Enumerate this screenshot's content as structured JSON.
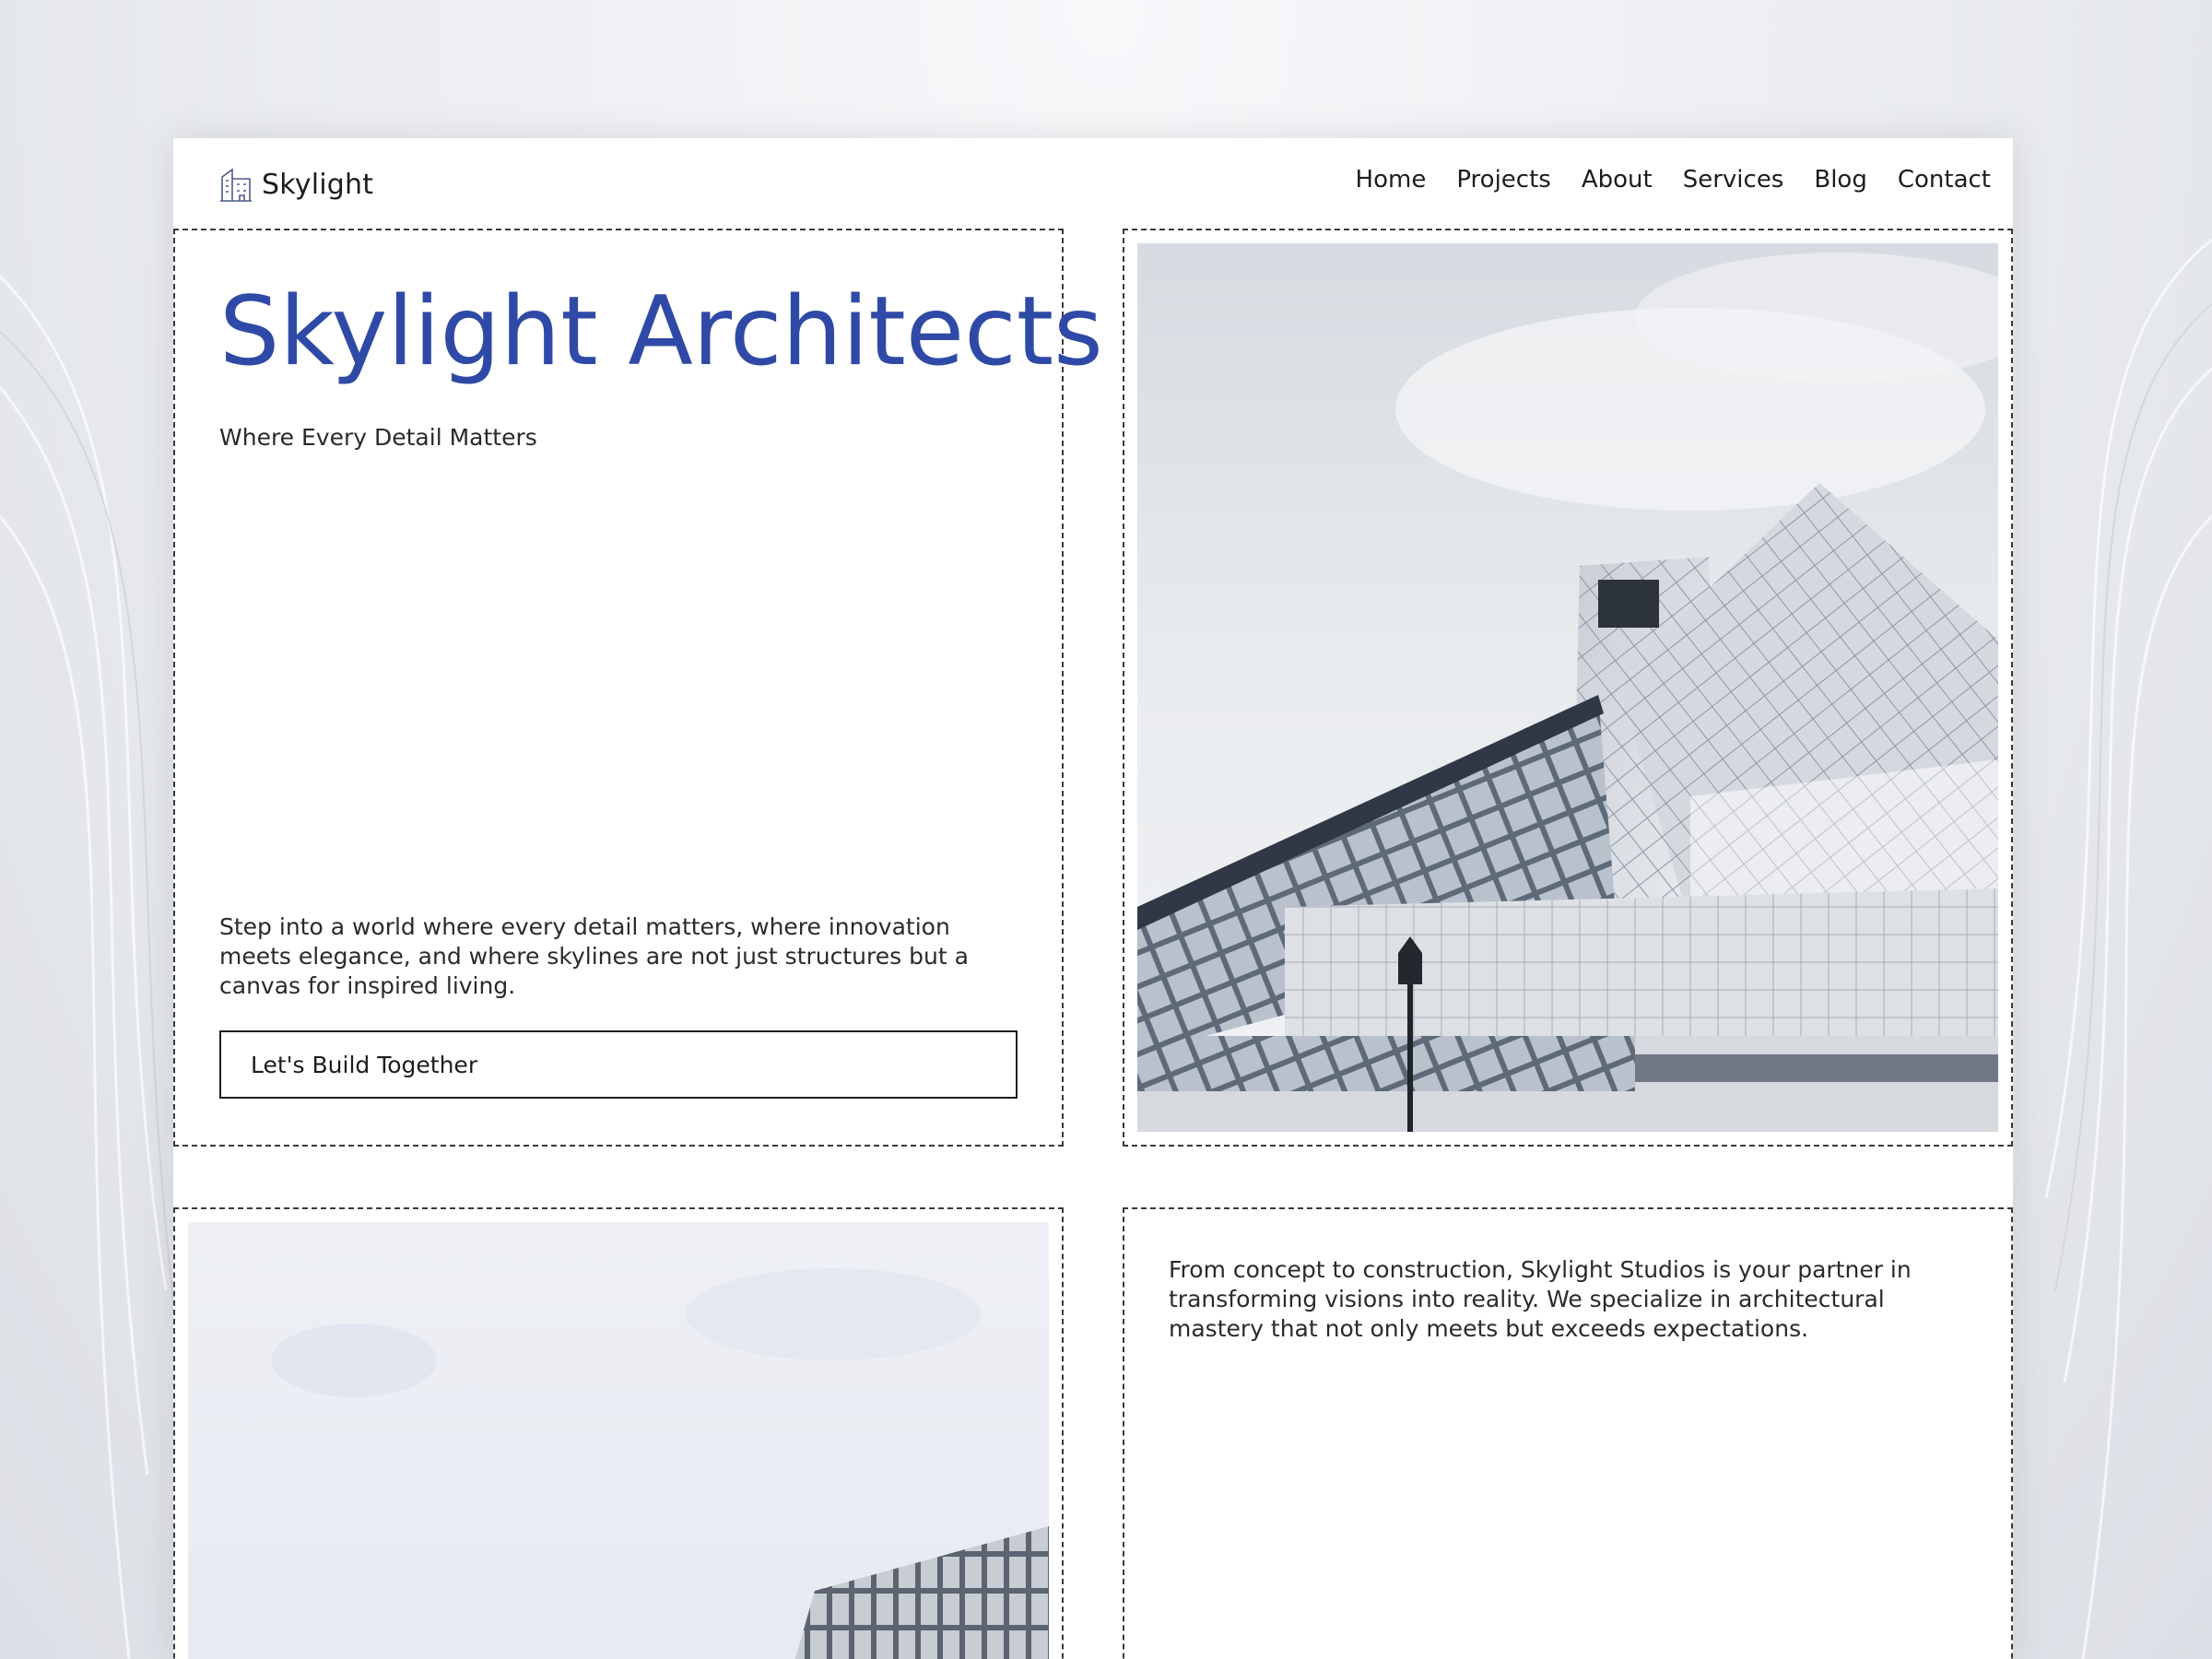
{
  "brand": {
    "name": "Skylight",
    "icon": "building-icon"
  },
  "nav": {
    "items": [
      "Home",
      "Projects",
      "About",
      "Services",
      "Blog",
      "Contact"
    ]
  },
  "hero": {
    "title": "Skylight Architects",
    "subtitle": "Where Every Detail Matters",
    "body": "Step into a world where every detail matters, where innovation meets elegance, and where skylines are not just structures but a canvas for inspired living.",
    "cta_label": "Let's Build Together"
  },
  "about": {
    "body": "From concept to construction, Skylight Studios is your partner in transforming visions into reality. We specialize in architectural mastery that not only meets but exceeds expectations."
  },
  "colors": {
    "accent": "#2f4aa6",
    "text": "#2a2a2a",
    "border": "#3a3a3a"
  }
}
